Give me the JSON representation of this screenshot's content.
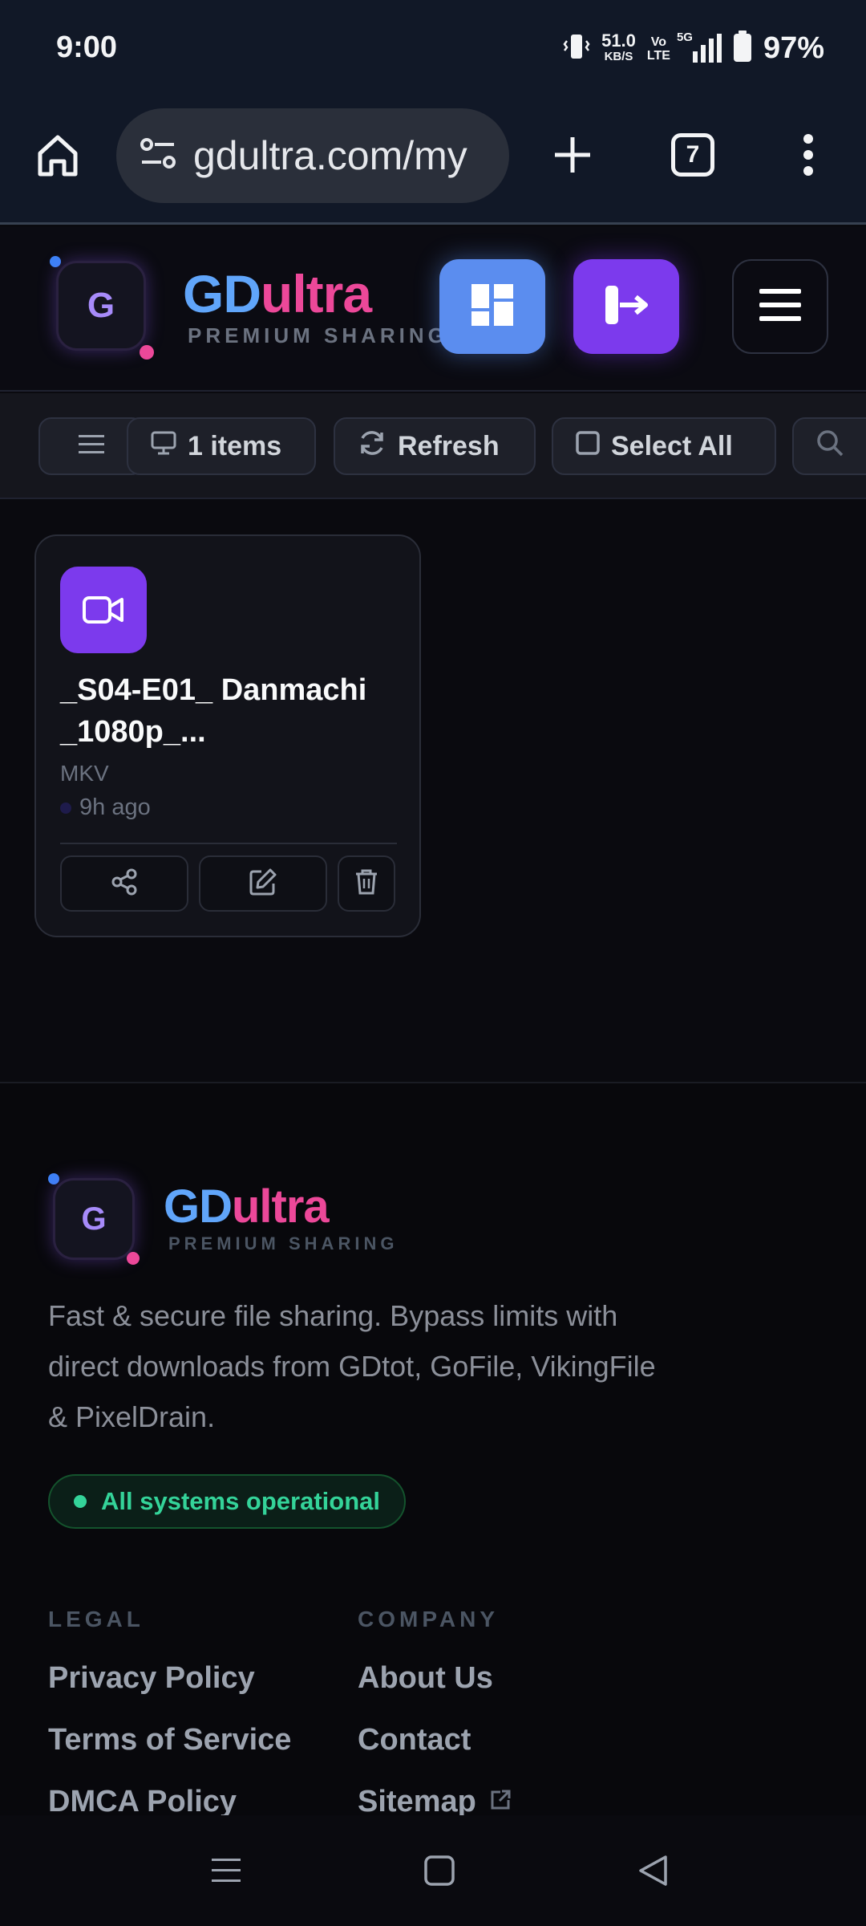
{
  "status_bar": {
    "time": "9:00",
    "net_speed": "51.0",
    "net_unit": "KB/S",
    "volte_top": "Vo",
    "volte_bottom": "LTE",
    "network": "5G",
    "battery": "97%"
  },
  "browser": {
    "url": "gdultra.com/my",
    "tab_count": "7"
  },
  "header": {
    "logo_letter": "G",
    "brand_gd": "GD",
    "brand_ultra": "ultra",
    "brand_sub": "PREMIUM SHARING",
    "accent_blue": "#5b8def",
    "accent_purple": "#7c3aed"
  },
  "toolbar": {
    "items_label": "1 items",
    "refresh_label": "Refresh",
    "select_all_label": "Select All"
  },
  "files": [
    {
      "name": "_S04-E01_ Danmachi _1080p_...",
      "type": "MKV",
      "time": "9h ago"
    }
  ],
  "footer": {
    "logo_letter": "G",
    "brand_gd": "GD",
    "brand_ultra": "ultra",
    "brand_sub": "PREMIUM SHARING",
    "description": "Fast & secure file sharing. Bypass limits with direct downloads from GDtot, GoFile, VikingFile & PixelDrain.",
    "status": "All systems operational",
    "legal_heading": "LEGAL",
    "company_heading": "COMPANY",
    "legal_links": [
      "Privacy Policy",
      "Terms of Service",
      "DMCA Policy"
    ],
    "company_links": [
      "About Us",
      "Contact",
      "Sitemap"
    ]
  }
}
